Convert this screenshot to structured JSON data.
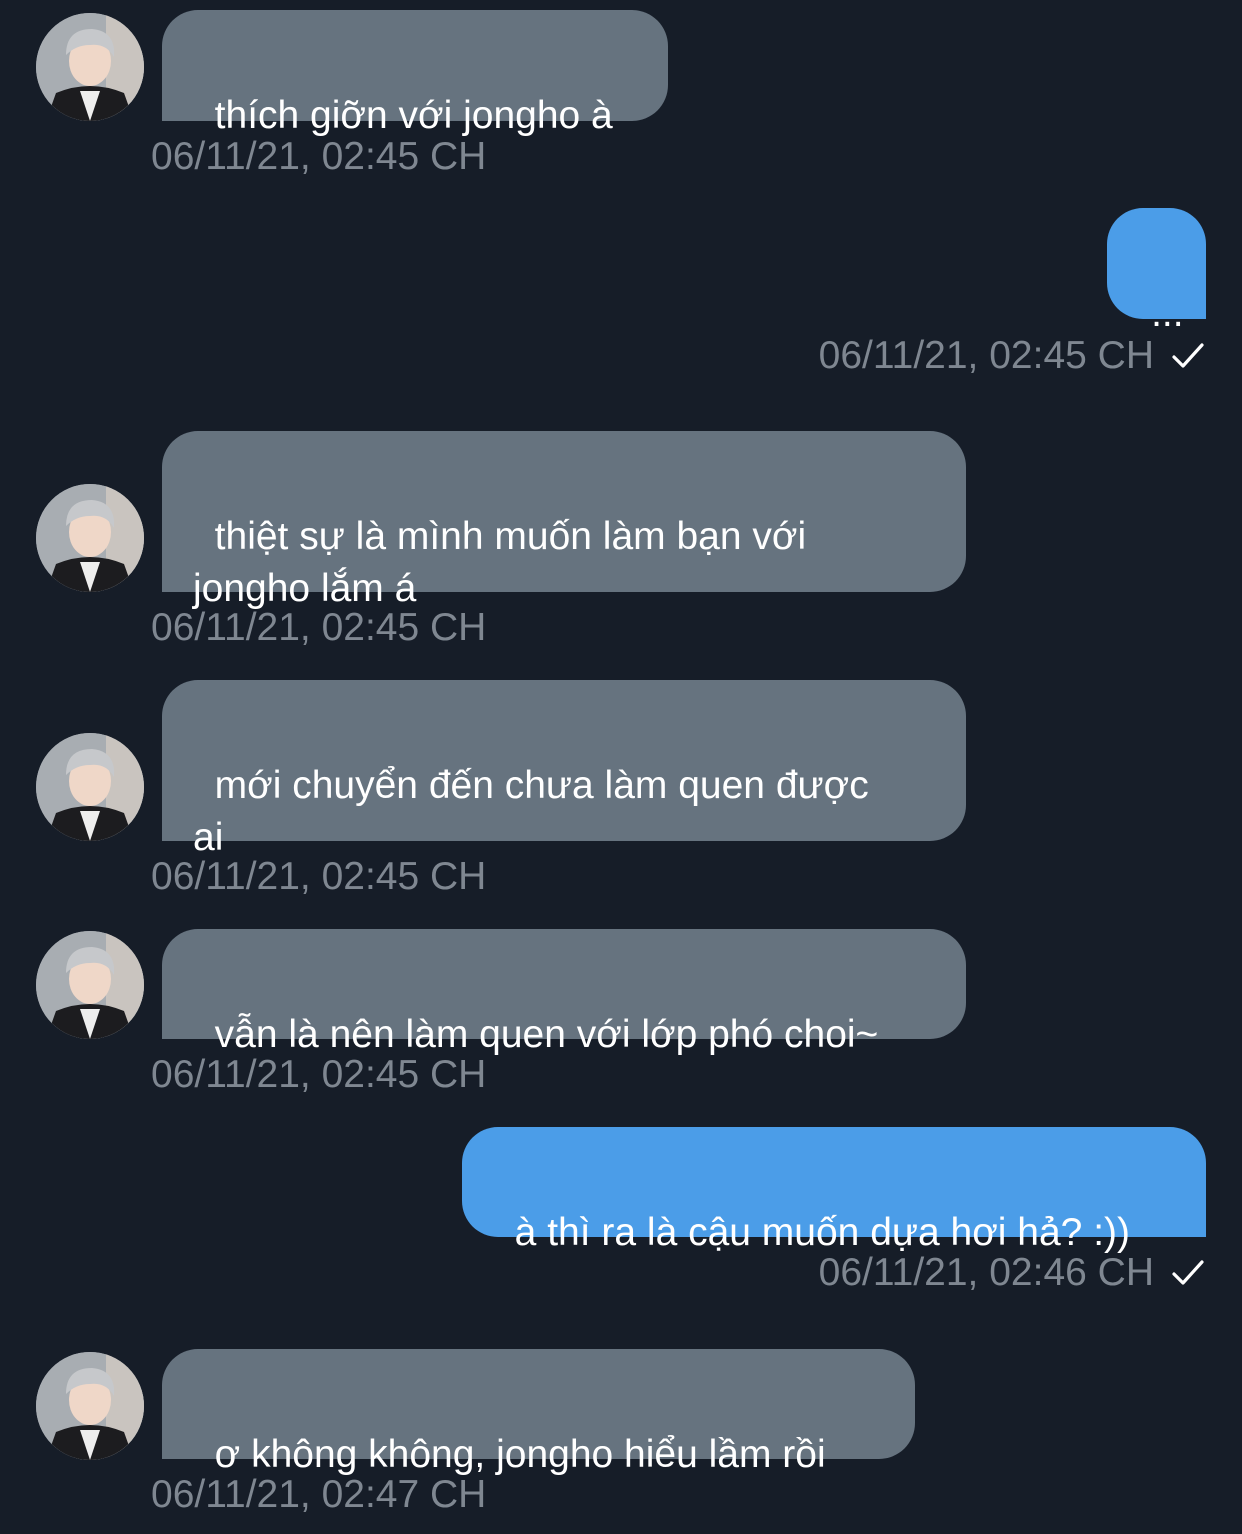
{
  "messages": [
    {
      "side": "in",
      "text": "thích giỡn với jongho à",
      "time": "06/11/21, 02:45 CH"
    },
    {
      "side": "out",
      "text": "...",
      "time": "06/11/21, 02:45 CH"
    },
    {
      "side": "in",
      "text": "thiệt sự là mình muốn làm bạn với\njongho lắm á",
      "time": "06/11/21, 02:45 CH"
    },
    {
      "side": "in",
      "text": "mới chuyển đến chưa làm quen được\nai",
      "time": "06/11/21, 02:45 CH"
    },
    {
      "side": "in",
      "text": "vẫn là nên làm quen với lớp phó choi~",
      "time": "06/11/21, 02:45 CH"
    },
    {
      "side": "out",
      "text": "à thì ra là cậu muốn dựa hơi hả? :))",
      "time": "06/11/21, 02:46 CH"
    },
    {
      "side": "in",
      "text": "ơ không không, jongho hiểu lầm rồi",
      "time": "06/11/21, 02:47 CH"
    }
  ],
  "icons": {
    "avatar": "avatar",
    "read_receipt": "checkmark-icon"
  },
  "colors": {
    "background": "#161d28",
    "incoming_bubble": "#66737f",
    "outgoing_bubble": "#4b9de8",
    "timestamp": "#7f8791",
    "text": "#ffffff"
  }
}
